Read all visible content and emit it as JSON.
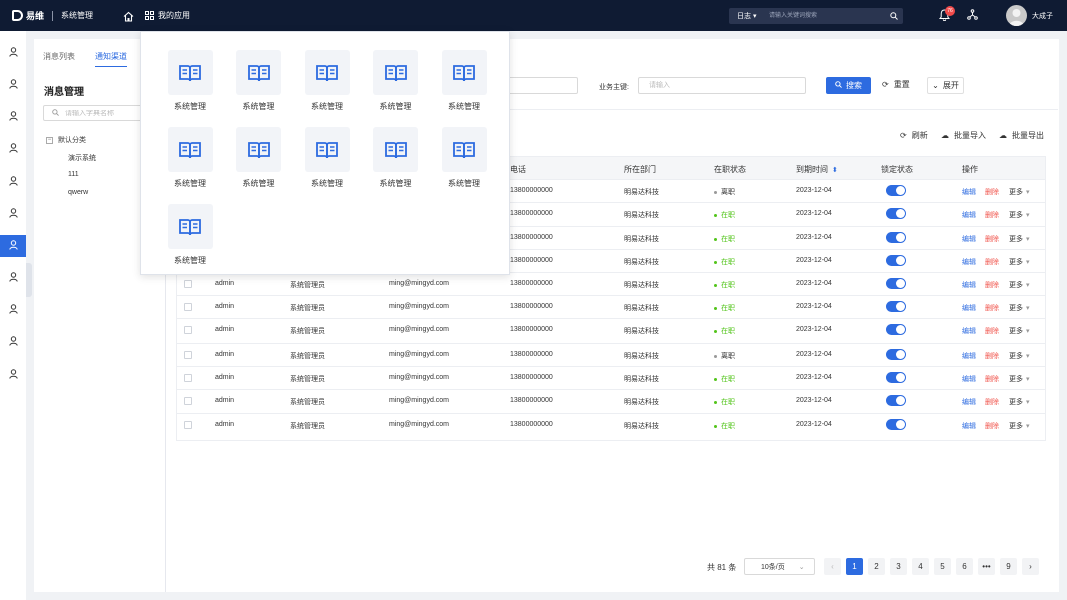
{
  "topbar": {
    "logo_text": "易维",
    "system_title": "系统管理",
    "apps_label": "我的应用",
    "search_category": "日志",
    "search_placeholder": "请输入关键词搜索",
    "notification_count": "76",
    "user_name": "大成子"
  },
  "rail": {
    "icons": [
      "user-icon",
      "user-icon",
      "user-icon",
      "user-icon",
      "user-icon",
      "user-icon",
      "user-icon",
      "user-icon",
      "user-icon",
      "user-icon",
      "user-icon"
    ],
    "active_index": 6
  },
  "side": {
    "tabs": [
      "消息列表",
      "通知渠道"
    ],
    "active_tab": 1,
    "title": "消息管理",
    "search_placeholder": "请输入字典名称",
    "tree": [
      {
        "label": "默认分类",
        "toggle": "−"
      },
      {
        "label": "演示系统"
      },
      {
        "label": "111"
      },
      {
        "label": "qwerw"
      }
    ]
  },
  "filter": {
    "business_key_label": "业务主键:",
    "business_key_placeholder": "请输入",
    "search_label": "搜索",
    "reset_label": "重置",
    "expand_label": "展开"
  },
  "toolbar": {
    "refresh_label": "刷新",
    "import_label": "批量导入",
    "export_label": "批量导出"
  },
  "table": {
    "headers": {
      "phone": "电话",
      "department": "所在部门",
      "status": "在职状态",
      "due": "到期时间",
      "lock": "锁定状态",
      "ops": "操作"
    },
    "rows": [
      {
        "user": "",
        "role": "",
        "email": "",
        "phone": "13800000000",
        "dept": "明易达科技",
        "status": "离职",
        "due": "2023-12-04",
        "locked": true
      },
      {
        "user": "",
        "role": "",
        "email": "",
        "phone": "13800000000",
        "dept": "明易达科技",
        "status": "在职",
        "due": "2023-12-04",
        "locked": true
      },
      {
        "user": "",
        "role": "",
        "email": "",
        "phone": "13800000000",
        "dept": "明易达科技",
        "status": "在职",
        "due": "2023-12-04",
        "locked": true
      },
      {
        "user": "",
        "role": "",
        "email": "",
        "phone": "13800000000",
        "dept": "明易达科技",
        "status": "在职",
        "due": "2023-12-04",
        "locked": true
      },
      {
        "user": "admin",
        "role": "系统管理员",
        "email": "ming@mingyd.com",
        "phone": "13800000000",
        "dept": "明易达科技",
        "status": "在职",
        "due": "2023-12-04",
        "locked": true
      },
      {
        "user": "admin",
        "role": "系统管理员",
        "email": "ming@mingyd.com",
        "phone": "13800000000",
        "dept": "明易达科技",
        "status": "在职",
        "due": "2023-12-04",
        "locked": true
      },
      {
        "user": "admin",
        "role": "系统管理员",
        "email": "ming@mingyd.com",
        "phone": "13800000000",
        "dept": "明易达科技",
        "status": "在职",
        "due": "2023-12-04",
        "locked": true
      },
      {
        "user": "admin",
        "role": "系统管理员",
        "email": "ming@mingyd.com",
        "phone": "13800000000",
        "dept": "明易达科技",
        "status": "离职",
        "due": "2023-12-04",
        "locked": true
      },
      {
        "user": "admin",
        "role": "系统管理员",
        "email": "ming@mingyd.com",
        "phone": "13800000000",
        "dept": "明易达科技",
        "status": "在职",
        "due": "2023-12-04",
        "locked": true
      },
      {
        "user": "admin",
        "role": "系统管理员",
        "email": "ming@mingyd.com",
        "phone": "13800000000",
        "dept": "明易达科技",
        "status": "在职",
        "due": "2023-12-04",
        "locked": true
      },
      {
        "user": "admin",
        "role": "系统管理员",
        "email": "ming@mingyd.com",
        "phone": "13800000000",
        "dept": "明易达科技",
        "status": "在职",
        "due": "2023-12-04",
        "locked": true
      }
    ],
    "op_edit": "编辑",
    "op_delete": "删除",
    "op_more": "更多"
  },
  "pager": {
    "total": "共 81 条",
    "page_size": "10条/页",
    "pages": [
      "1",
      "2",
      "3",
      "4",
      "5",
      "6",
      "•••",
      "9"
    ],
    "current": "1"
  },
  "apps_dropdown": {
    "items": [
      "系统管理",
      "系统管理",
      "系统管理",
      "系统管理",
      "系统管理",
      "系统管理",
      "系统管理",
      "系统管理",
      "系统管理",
      "系统管理",
      "系统管理"
    ]
  },
  "colors": {
    "primary": "#2d6be0",
    "topbar_bg": "#0f1b33",
    "danger": "#f0524a",
    "active_status": "#52c41a",
    "inactive_status": "#999999"
  }
}
